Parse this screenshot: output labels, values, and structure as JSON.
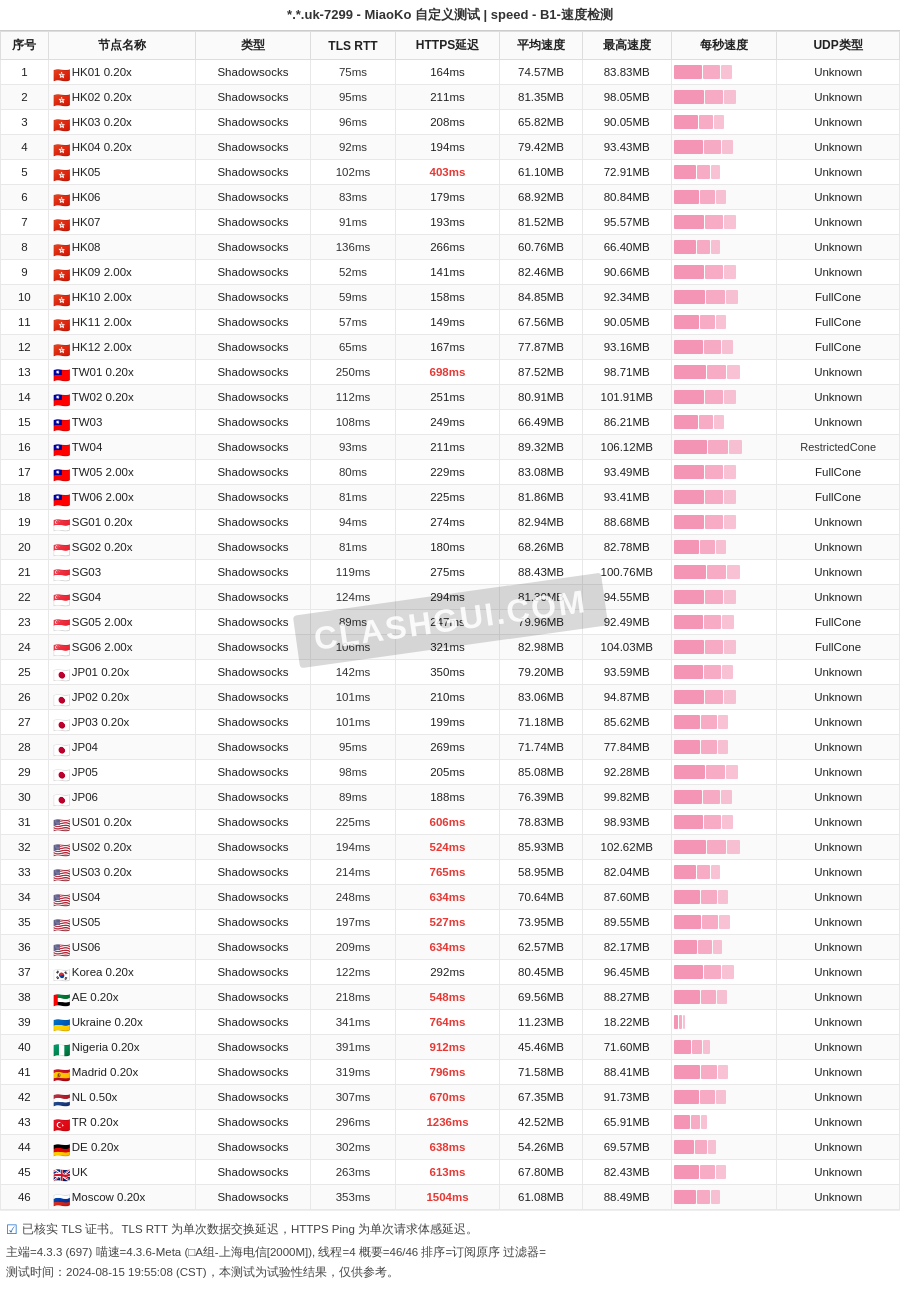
{
  "title": "*.*.uk-7299 - MiaoKo 自定义测试 | speed - B1-速度检测",
  "columns": [
    "序号",
    "节点名称",
    "类型",
    "TLS RTT",
    "HTTPS延迟",
    "平均速度",
    "最高速度",
    "每秒速度",
    "UDP类型"
  ],
  "rows": [
    {
      "id": 1,
      "flag": "🇭🇰",
      "name": "HK01 0.20x",
      "type": "Shadowsocks",
      "tls": "75ms",
      "https": "164ms",
      "avg": "74.57MB",
      "max": "83.83MB",
      "bar": 75,
      "udp": "Unknown"
    },
    {
      "id": 2,
      "flag": "🇭🇰",
      "name": "HK02 0.20x",
      "type": "Shadowsocks",
      "tls": "95ms",
      "https": "211ms",
      "avg": "81.35MB",
      "max": "98.05MB",
      "bar": 82,
      "udp": "Unknown"
    },
    {
      "id": 3,
      "flag": "🇭🇰",
      "name": "HK03 0.20x",
      "type": "Shadowsocks",
      "tls": "96ms",
      "https": "208ms",
      "avg": "65.82MB",
      "max": "90.05MB",
      "bar": 66,
      "udp": "Unknown"
    },
    {
      "id": 4,
      "flag": "🇭🇰",
      "name": "HK04 0.20x",
      "type": "Shadowsocks",
      "tls": "92ms",
      "https": "194ms",
      "avg": "79.42MB",
      "max": "93.43MB",
      "bar": 79,
      "udp": "Unknown"
    },
    {
      "id": 5,
      "flag": "🇭🇰",
      "name": "HK05",
      "type": "Shadowsocks",
      "tls": "102ms",
      "https": "403ms",
      "avg": "61.10MB",
      "max": "72.91MB",
      "bar": 61,
      "udp": "Unknown"
    },
    {
      "id": 6,
      "flag": "🇭🇰",
      "name": "HK06",
      "type": "Shadowsocks",
      "tls": "83ms",
      "https": "179ms",
      "avg": "68.92MB",
      "max": "80.84MB",
      "bar": 69,
      "udp": "Unknown"
    },
    {
      "id": 7,
      "flag": "🇭🇰",
      "name": "HK07",
      "type": "Shadowsocks",
      "tls": "91ms",
      "https": "193ms",
      "avg": "81.52MB",
      "max": "95.57MB",
      "bar": 82,
      "udp": "Unknown"
    },
    {
      "id": 8,
      "flag": "🇭🇰",
      "name": "HK08",
      "type": "Shadowsocks",
      "tls": "136ms",
      "https": "266ms",
      "avg": "60.76MB",
      "max": "66.40MB",
      "bar": 61,
      "udp": "Unknown"
    },
    {
      "id": 9,
      "flag": "🇭🇰",
      "name": "HK09 2.00x",
      "type": "Shadowsocks",
      "tls": "52ms",
      "https": "141ms",
      "avg": "82.46MB",
      "max": "90.66MB",
      "bar": 82,
      "udp": "Unknown"
    },
    {
      "id": 10,
      "flag": "🇭🇰",
      "name": "HK10 2.00x",
      "type": "Shadowsocks",
      "tls": "59ms",
      "https": "158ms",
      "avg": "84.85MB",
      "max": "92.34MB",
      "bar": 85,
      "udp": "FullCone"
    },
    {
      "id": 11,
      "flag": "🇭🇰",
      "name": "HK11 2.00x",
      "type": "Shadowsocks",
      "tls": "57ms",
      "https": "149ms",
      "avg": "67.56MB",
      "max": "90.05MB",
      "bar": 68,
      "udp": "FullCone"
    },
    {
      "id": 12,
      "flag": "🇭🇰",
      "name": "HK12 2.00x",
      "type": "Shadowsocks",
      "tls": "65ms",
      "https": "167ms",
      "avg": "77.87MB",
      "max": "93.16MB",
      "bar": 78,
      "udp": "FullCone"
    },
    {
      "id": 13,
      "flag": "🇹🇼",
      "name": "TW01 0.20x",
      "type": "Shadowsocks",
      "tls": "250ms",
      "https": "698ms",
      "avg": "87.52MB",
      "max": "98.71MB",
      "bar": 88,
      "udp": "Unknown"
    },
    {
      "id": 14,
      "flag": "🇹🇼",
      "name": "TW02 0.20x",
      "type": "Shadowsocks",
      "tls": "112ms",
      "https": "251ms",
      "avg": "80.91MB",
      "max": "101.91MB",
      "bar": 81,
      "udp": "Unknown"
    },
    {
      "id": 15,
      "flag": "🇹🇼",
      "name": "TW03",
      "type": "Shadowsocks",
      "tls": "108ms",
      "https": "249ms",
      "avg": "66.49MB",
      "max": "86.21MB",
      "bar": 66,
      "udp": "Unknown"
    },
    {
      "id": 16,
      "flag": "🇹🇼",
      "name": "TW04",
      "type": "Shadowsocks",
      "tls": "93ms",
      "https": "211ms",
      "avg": "89.32MB",
      "max": "106.12MB",
      "bar": 89,
      "udp": "RestrictedCone"
    },
    {
      "id": 17,
      "flag": "🇹🇼",
      "name": "TW05 2.00x",
      "type": "Shadowsocks",
      "tls": "80ms",
      "https": "229ms",
      "avg": "83.08MB",
      "max": "93.49MB",
      "bar": 83,
      "udp": "FullCone"
    },
    {
      "id": 18,
      "flag": "🇹🇼",
      "name": "TW06 2.00x",
      "type": "Shadowsocks",
      "tls": "81ms",
      "https": "225ms",
      "avg": "81.86MB",
      "max": "93.41MB",
      "bar": 82,
      "udp": "FullCone"
    },
    {
      "id": 19,
      "flag": "🇸🇬",
      "name": "SG01 0.20x",
      "type": "Shadowsocks",
      "tls": "94ms",
      "https": "274ms",
      "avg": "82.94MB",
      "max": "88.68MB",
      "bar": 83,
      "udp": "Unknown"
    },
    {
      "id": 20,
      "flag": "🇸🇬",
      "name": "SG02 0.20x",
      "type": "Shadowsocks",
      "tls": "81ms",
      "https": "180ms",
      "avg": "68.26MB",
      "max": "82.78MB",
      "bar": 68,
      "udp": "Unknown"
    },
    {
      "id": 21,
      "flag": "🇸🇬",
      "name": "SG03",
      "type": "Shadowsocks",
      "tls": "119ms",
      "https": "275ms",
      "avg": "88.43MB",
      "max": "100.76MB",
      "bar": 88,
      "udp": "Unknown"
    },
    {
      "id": 22,
      "flag": "🇸🇬",
      "name": "SG04",
      "type": "Shadowsocks",
      "tls": "124ms",
      "https": "294ms",
      "avg": "81.30MB",
      "max": "94.55MB",
      "bar": 81,
      "udp": "Unknown"
    },
    {
      "id": 23,
      "flag": "🇸🇬",
      "name": "SG05 2.00x",
      "type": "Shadowsocks",
      "tls": "89ms",
      "https": "247ms",
      "avg": "79.96MB",
      "max": "92.49MB",
      "bar": 80,
      "udp": "FullCone"
    },
    {
      "id": 24,
      "flag": "🇸🇬",
      "name": "SG06 2.00x",
      "type": "Shadowsocks",
      "tls": "106ms",
      "https": "321ms",
      "avg": "82.98MB",
      "max": "104.03MB",
      "bar": 83,
      "udp": "FullCone"
    },
    {
      "id": 25,
      "flag": "🇯🇵",
      "name": "JP01 0.20x",
      "type": "Shadowsocks",
      "tls": "142ms",
      "https": "350ms",
      "avg": "79.20MB",
      "max": "93.59MB",
      "bar": 79,
      "udp": "Unknown"
    },
    {
      "id": 26,
      "flag": "🇯🇵",
      "name": "JP02 0.20x",
      "type": "Shadowsocks",
      "tls": "101ms",
      "https": "210ms",
      "avg": "83.06MB",
      "max": "94.87MB",
      "bar": 83,
      "udp": "Unknown"
    },
    {
      "id": 27,
      "flag": "🇯🇵",
      "name": "JP03 0.20x",
      "type": "Shadowsocks",
      "tls": "101ms",
      "https": "199ms",
      "avg": "71.18MB",
      "max": "85.62MB",
      "bar": 71,
      "udp": "Unknown"
    },
    {
      "id": 28,
      "flag": "🇯🇵",
      "name": "JP04",
      "type": "Shadowsocks",
      "tls": "95ms",
      "https": "269ms",
      "avg": "71.74MB",
      "max": "77.84MB",
      "bar": 72,
      "udp": "Unknown"
    },
    {
      "id": 29,
      "flag": "🇯🇵",
      "name": "JP05",
      "type": "Shadowsocks",
      "tls": "98ms",
      "https": "205ms",
      "avg": "85.08MB",
      "max": "92.28MB",
      "bar": 85,
      "udp": "Unknown"
    },
    {
      "id": 30,
      "flag": "🇯🇵",
      "name": "JP06",
      "type": "Shadowsocks",
      "tls": "89ms",
      "https": "188ms",
      "avg": "76.39MB",
      "max": "99.82MB",
      "bar": 76,
      "udp": "Unknown"
    },
    {
      "id": 31,
      "flag": "🇺🇸",
      "name": "US01 0.20x",
      "type": "Shadowsocks",
      "tls": "225ms",
      "https": "606ms",
      "avg": "78.83MB",
      "max": "98.93MB",
      "bar": 79,
      "udp": "Unknown"
    },
    {
      "id": 32,
      "flag": "🇺🇸",
      "name": "US02 0.20x",
      "type": "Shadowsocks",
      "tls": "194ms",
      "https": "524ms",
      "avg": "85.93MB",
      "max": "102.62MB",
      "bar": 86,
      "udp": "Unknown"
    },
    {
      "id": 33,
      "flag": "🇺🇸",
      "name": "US03 0.20x",
      "type": "Shadowsocks",
      "tls": "214ms",
      "https": "765ms",
      "avg": "58.95MB",
      "max": "82.04MB",
      "bar": 59,
      "udp": "Unknown"
    },
    {
      "id": 34,
      "flag": "🇺🇸",
      "name": "US04",
      "type": "Shadowsocks",
      "tls": "248ms",
      "https": "634ms",
      "avg": "70.64MB",
      "max": "87.60MB",
      "bar": 71,
      "udp": "Unknown"
    },
    {
      "id": 35,
      "flag": "🇺🇸",
      "name": "US05",
      "type": "Shadowsocks",
      "tls": "197ms",
      "https": "527ms",
      "avg": "73.95MB",
      "max": "89.55MB",
      "bar": 74,
      "udp": "Unknown"
    },
    {
      "id": 36,
      "flag": "🇺🇸",
      "name": "US06",
      "type": "Shadowsocks",
      "tls": "209ms",
      "https": "634ms",
      "avg": "62.57MB",
      "max": "82.17MB",
      "bar": 63,
      "udp": "Unknown"
    },
    {
      "id": 37,
      "flag": "🇰🇷",
      "name": "Korea 0.20x",
      "type": "Shadowsocks",
      "tls": "122ms",
      "https": "292ms",
      "avg": "80.45MB",
      "max": "96.45MB",
      "bar": 80,
      "udp": "Unknown"
    },
    {
      "id": 38,
      "flag": "🇦🇪",
      "name": "AE 0.20x",
      "type": "Shadowsocks",
      "tls": "218ms",
      "https": "548ms",
      "avg": "69.56MB",
      "max": "88.27MB",
      "bar": 70,
      "udp": "Unknown"
    },
    {
      "id": 39,
      "flag": "🇺🇦",
      "name": "Ukraine 0.20x",
      "type": "Shadowsocks",
      "tls": "341ms",
      "https": "764ms",
      "avg": "11.23MB",
      "max": "18.22MB",
      "bar": 11,
      "udp": "Unknown"
    },
    {
      "id": 40,
      "flag": "🇳🇬",
      "name": "Nigeria 0.20x",
      "type": "Shadowsocks",
      "tls": "391ms",
      "https": "912ms",
      "avg": "45.46MB",
      "max": "71.60MB",
      "bar": 45,
      "udp": "Unknown"
    },
    {
      "id": 41,
      "flag": "🇪🇸",
      "name": "Madrid 0.20x",
      "type": "Shadowsocks",
      "tls": "319ms",
      "https": "796ms",
      "avg": "71.58MB",
      "max": "88.41MB",
      "bar": 72,
      "udp": "Unknown"
    },
    {
      "id": 42,
      "flag": "🇳🇱",
      "name": "NL 0.50x",
      "type": "Shadowsocks",
      "tls": "307ms",
      "https": "670ms",
      "avg": "67.35MB",
      "max": "91.73MB",
      "bar": 67,
      "udp": "Unknown"
    },
    {
      "id": 43,
      "flag": "🇹🇷",
      "name": "TR 0.20x",
      "type": "Shadowsocks",
      "tls": "296ms",
      "https": "1236ms",
      "avg": "42.52MB",
      "max": "65.91MB",
      "bar": 43,
      "udp": "Unknown"
    },
    {
      "id": 44,
      "flag": "🇩🇪",
      "name": "DE 0.20x",
      "type": "Shadowsocks",
      "tls": "302ms",
      "https": "638ms",
      "avg": "54.26MB",
      "max": "69.57MB",
      "bar": 54,
      "udp": "Unknown"
    },
    {
      "id": 45,
      "flag": "🇬🇧",
      "name": "UK",
      "type": "Shadowsocks",
      "tls": "263ms",
      "https": "613ms",
      "avg": "67.80MB",
      "max": "82.43MB",
      "bar": 68,
      "udp": "Unknown"
    },
    {
      "id": 46,
      "flag": "🇷🇺",
      "name": "Moscow 0.20x",
      "type": "Shadowsocks",
      "tls": "353ms",
      "https": "1504ms",
      "avg": "61.08MB",
      "max": "88.49MB",
      "bar": 61,
      "udp": "Unknown"
    }
  ],
  "footer": {
    "cert_note": "已核实 TLS 证书。TLS RTT 为单次数据交换延迟，HTTPS Ping 为单次请求体感延迟。",
    "main_info": "主端=4.3.3 (697) 喵速=4.3.6-Meta (□A组-上海电信[2000M]), 线程=4 概要=46/46 排序=订阅原序 过滤器=",
    "test_time": "测试时间：2024-08-15 19:55:08 (CST)，本测试为试验性结果，仅供参考。"
  },
  "https_highlight_rows": [
    5,
    13,
    31,
    32,
    33,
    34,
    35,
    36,
    43,
    46
  ],
  "watermark": "CLASHGUI.COM"
}
